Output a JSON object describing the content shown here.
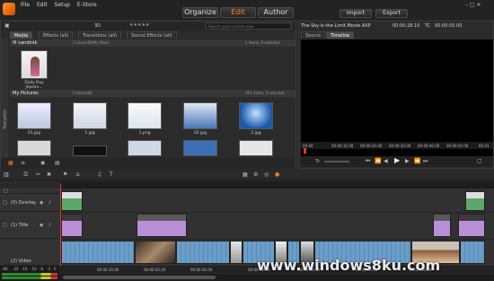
{
  "menu": [
    "File",
    "Edit",
    "Setup",
    "E-Store"
  ],
  "modes": {
    "organize": "Organize",
    "edit": "Edit",
    "author": "Author"
  },
  "actions": {
    "import": "Import",
    "export": "Export"
  },
  "project": {
    "name": "The-Sky-is-the-Limit.Movie.AXP",
    "timecode": "00:00:28.10",
    "tc_label": "TC",
    "tc_value": "00:00:00.00"
  },
  "library": {
    "tabs": [
      "Media",
      "Effects (all)",
      "Transitions (all)",
      "Sound Effects (all)"
    ],
    "view_3d": "3D",
    "search_placeholder": "Search your current view",
    "side_label": "Navigation",
    "sections": [
      {
        "title": "fil vandinik",
        "path": "C:\\Users\\fil\\My Music",
        "count": "1 items, 0 selected",
        "items": [
          {
            "label": "Daily Ray Jepsen..."
          }
        ]
      },
      {
        "title": "My Pictures",
        "path": "C:\\Users\\fil",
        "count": "351 items, 0 selected",
        "items": [
          {
            "label": "01.jpg"
          },
          {
            "label": "1.jpg"
          },
          {
            "label": "1.png"
          },
          {
            "label": "02.jpg"
          },
          {
            "label": "2.jpg"
          }
        ]
      }
    ]
  },
  "player": {
    "tabs": [
      "Source",
      "Timeline"
    ],
    "ruler": [
      "00:00",
      "00:00:10.00",
      "00:00:20.00",
      "00:00:30.00",
      "00:00:40.00",
      "00:00:50.00",
      "00:01"
    ]
  },
  "timeline": {
    "tracks": [
      {
        "name": "(0) Overlay"
      },
      {
        "name": "(1) Title"
      },
      {
        "name": "(2) Video"
      }
    ],
    "ruler": [
      "00:00:10.00",
      "00:00:20.00",
      "00:00:30.00",
      "00:00:40.00",
      "00:00:50.00",
      "00:01:00.00",
      "00:01:10.00"
    ],
    "meter": [
      "-60",
      "-22",
      "-16",
      "-10",
      "-6",
      "-3",
      "0"
    ]
  },
  "watermark": "www.windows8ku.com",
  "colors": {
    "accent": "#ff7a1a",
    "title_clip": "#b98fd8",
    "overlay_clip": "#5ca86b",
    "video_clip": "#6a9ec8"
  }
}
